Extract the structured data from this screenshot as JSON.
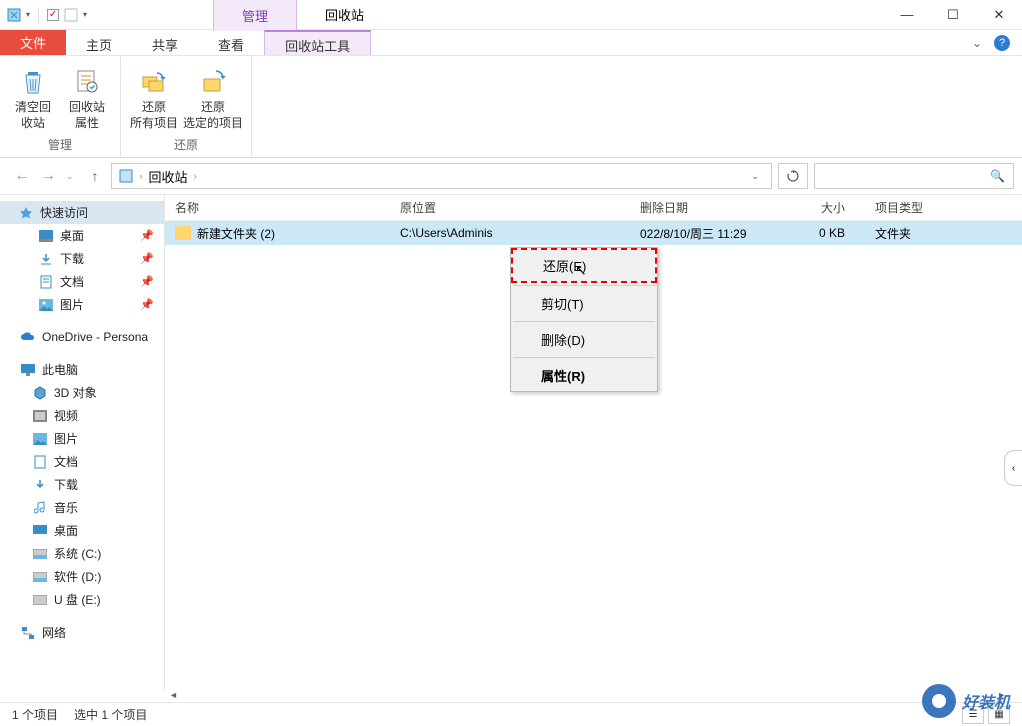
{
  "titlebar": {
    "manage": "管理",
    "app_title": "回收站"
  },
  "win": {
    "min": "—",
    "max": "☐",
    "close": "✕"
  },
  "ribbon_tabs": {
    "file": "文件",
    "home": "主页",
    "share": "共享",
    "view": "查看",
    "tools": "回收站工具",
    "caret": "⌄",
    "help": "?"
  },
  "ribbon": {
    "group_manage": "管理",
    "group_restore": "还原",
    "empty": "清空回\n收站",
    "props": "回收站\n属性",
    "restore_all": "还原\n所有项目",
    "restore_sel": "还原\n选定的项目"
  },
  "nav": {
    "crumb": "回收站",
    "sep": "›"
  },
  "search": {
    "icon": "🔍"
  },
  "tree": {
    "quick": "快速访问",
    "desktop": "桌面",
    "downloads": "下载",
    "documents": "文档",
    "pictures": "图片",
    "onedrive": "OneDrive - Persona",
    "thispc": "此电脑",
    "objects3d": "3D 对象",
    "videos": "视频",
    "pictures2": "图片",
    "documents2": "文档",
    "downloads2": "下载",
    "music": "音乐",
    "desktop2": "桌面",
    "drive_c": "系统 (C:)",
    "drive_d": "软件 (D:)",
    "drive_e": "U 盘 (E:)",
    "network": "网络"
  },
  "cols": {
    "name": "名称",
    "orig": "原位置",
    "date": "删除日期",
    "size": "大小",
    "type": "项目类型"
  },
  "row": {
    "name": "新建文件夹 (2)",
    "orig": "C:\\Users\\Adminis",
    "date": "022/8/10/周三 11:29",
    "size": "0 KB",
    "type": "文件夹"
  },
  "ctx": {
    "restore": "还原(E)",
    "cut": "剪切(T)",
    "delete": "删除(D)",
    "props": "属性(R)"
  },
  "status": {
    "count": "1 个项目",
    "selected": "选中 1 个项目"
  },
  "watermark": "好装机"
}
